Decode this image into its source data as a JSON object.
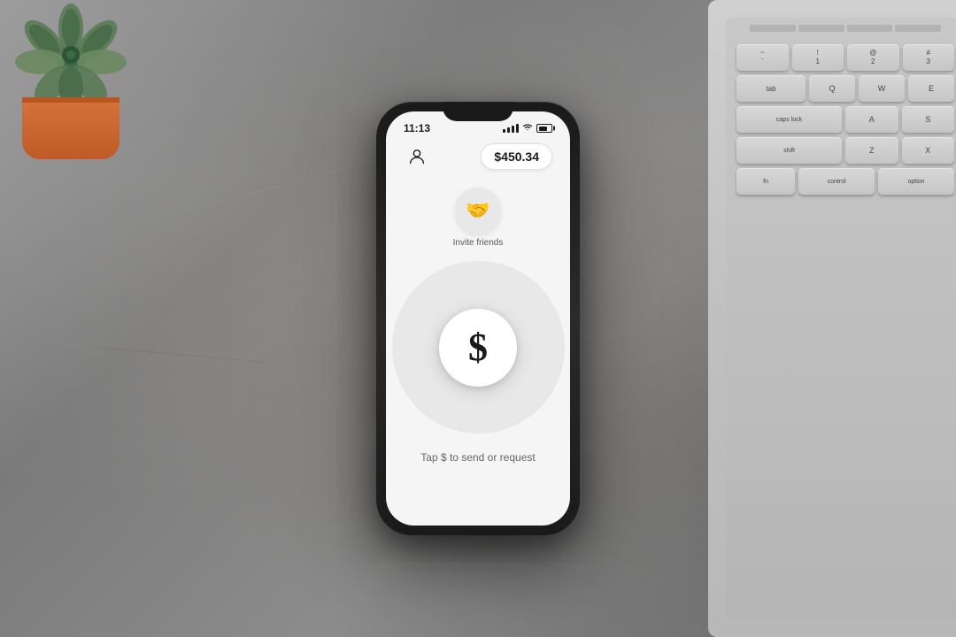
{
  "background": {
    "color": "#8a8a8a"
  },
  "phone": {
    "status_bar": {
      "time": "11:13",
      "signal": "full",
      "wifi": true,
      "battery_level": "70%"
    },
    "app": {
      "balance": "$450.34",
      "invite_label": "Invite friends",
      "instruction": "Tap $ to send or request",
      "dollar_sign": "$"
    }
  },
  "keyboard": {
    "keys": [
      {
        "label": "~\n`",
        "wide": false
      },
      {
        "label": "!\n1",
        "wide": false
      },
      {
        "label": "@\n2",
        "wide": false
      },
      {
        "label": "tab",
        "wide": true
      },
      {
        "label": "Q",
        "wide": false
      },
      {
        "label": "caps lock",
        "wide": true
      },
      {
        "label": "A",
        "wide": false
      },
      {
        "label": "shift",
        "wide": true
      },
      {
        "label": "Z",
        "wide": false
      },
      {
        "label": "fn",
        "wide": false
      },
      {
        "label": "control",
        "wide": false
      },
      {
        "label": "option",
        "wide": false
      }
    ]
  }
}
